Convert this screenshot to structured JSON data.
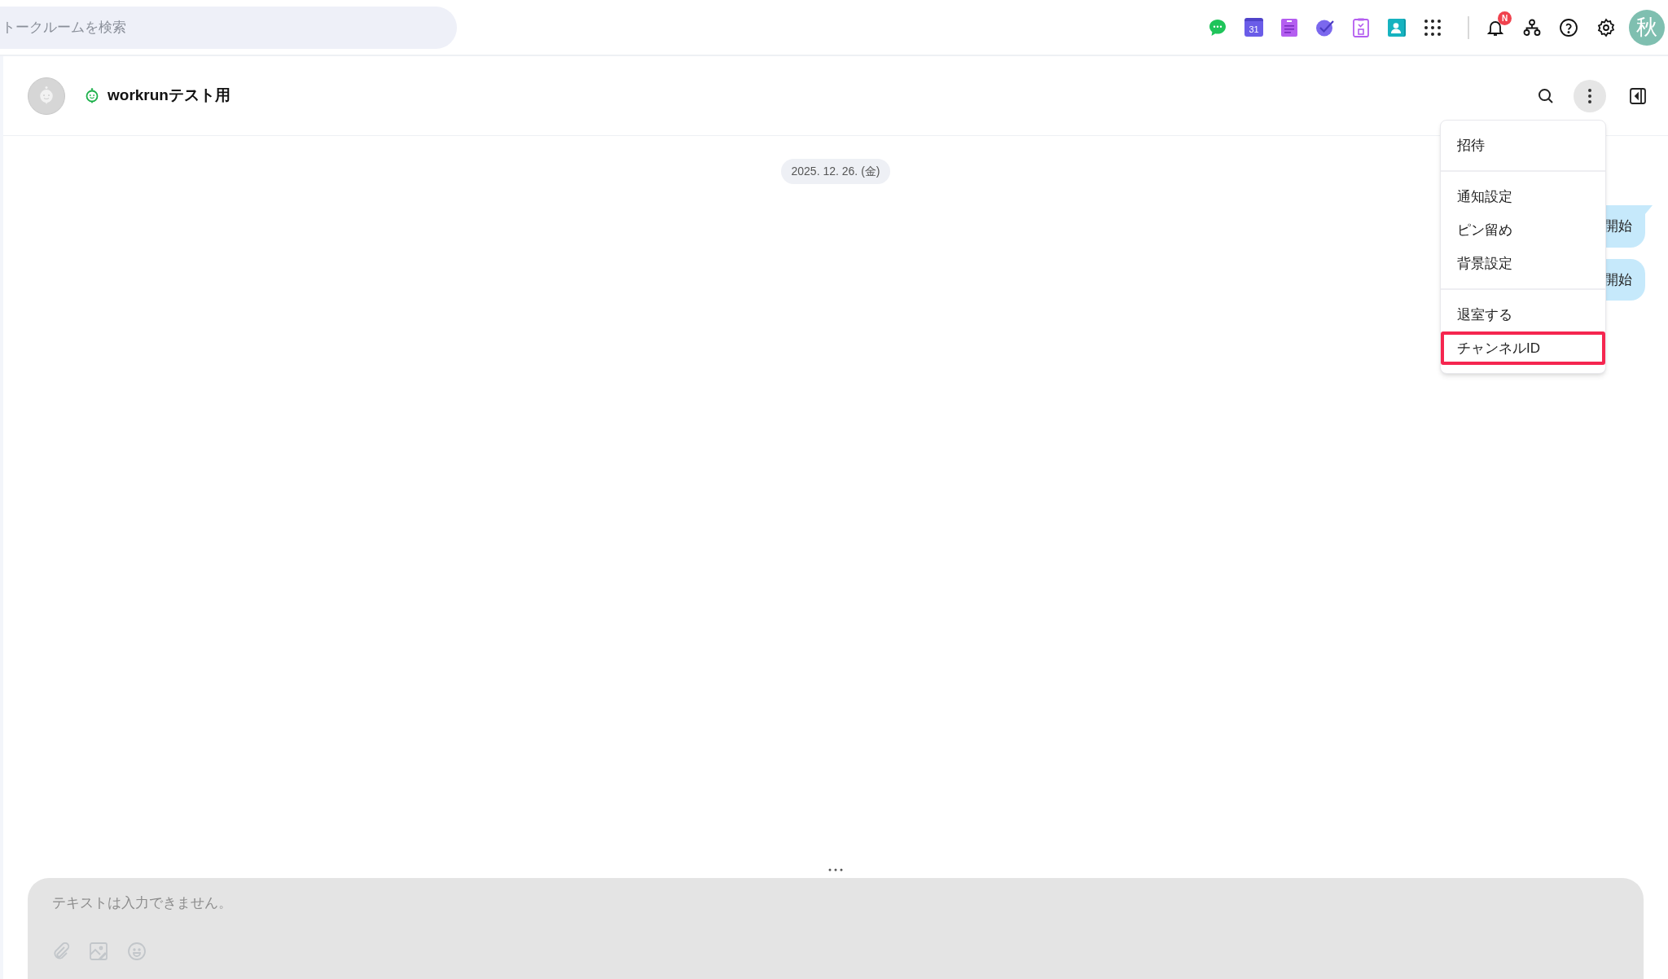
{
  "search": {
    "placeholder": "トークルームを検索"
  },
  "app_icons": [
    {
      "kind": "chat"
    },
    {
      "kind": "calendar",
      "label": "31"
    },
    {
      "kind": "note"
    },
    {
      "kind": "task"
    },
    {
      "kind": "clipboard"
    },
    {
      "kind": "contact"
    },
    {
      "kind": "grid"
    }
  ],
  "notification_badge": "N",
  "user_avatar": "秋",
  "channel": {
    "title": "workrunテスト用"
  },
  "date_label": "2025. 12. 26. (金)",
  "messages": [
    {
      "text": "開始",
      "tail": true
    },
    {
      "text": "開始",
      "tail": false
    }
  ],
  "menu": {
    "groups": [
      {
        "items": [
          {
            "label": "招待",
            "highlighted": false
          }
        ]
      },
      {
        "items": [
          {
            "label": "通知設定",
            "highlighted": false
          },
          {
            "label": "ピン留め",
            "highlighted": false
          },
          {
            "label": "背景設定",
            "highlighted": false
          }
        ]
      },
      {
        "items": [
          {
            "label": "退室する",
            "highlighted": false
          },
          {
            "label": "チャンネルID",
            "highlighted": true
          }
        ]
      }
    ]
  },
  "composer": {
    "placeholder": "テキストは入力できません。"
  }
}
